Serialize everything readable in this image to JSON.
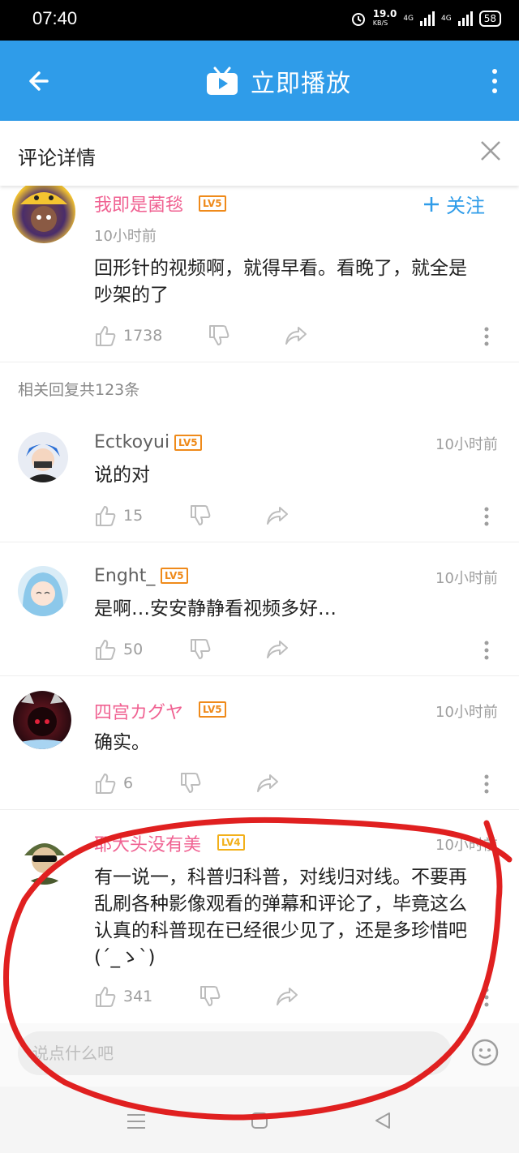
{
  "status": {
    "time": "07:40",
    "speed": "19.0",
    "speed_unit": "KB/S",
    "net1": "4G",
    "net2": "4G",
    "battery": "58"
  },
  "appbar": {
    "title": "立即播放",
    "icons": [
      "back-arrow-icon",
      "tv-play-icon",
      "more-vert-icon"
    ],
    "color": "#2f9ce9"
  },
  "detail": {
    "title": "评论详情"
  },
  "main_comment": {
    "user": "我即是菌毯",
    "level": "LV5",
    "follow": "关注",
    "time": "10小时前",
    "text_line1": "回形针的视频啊，就得早看。看晚了，就全是",
    "text_line2": "吵架的了",
    "likes": "1738"
  },
  "reply_count": "相关回复共123条",
  "replies": [
    {
      "user": "Ectkoyui",
      "level": "LV5",
      "time": "10小时前",
      "text": "说的对",
      "likes": "15"
    },
    {
      "user": "Enght_",
      "level": "LV5",
      "time": "10小时前",
      "text": "是啊…安安静静看视频多好…",
      "likes": "50"
    },
    {
      "user": "四宫カグヤ",
      "level": "LV5",
      "time": "10小时前",
      "text": "确实。",
      "likes": "6"
    },
    {
      "user": "耶大头没有美",
      "level": "LV4",
      "time": "10小时前",
      "line1": "有一说一，科普归科普，对线归对线。不要再",
      "line2": "乱刷各种影像观看的弹幕和评论了，毕竟这么",
      "line3": "认真的科普现在已经很少见了，还是多珍惜吧",
      "line4": "(´_ゝ`)",
      "likes": "341"
    }
  ],
  "input": {
    "placeholder": "说点什么吧"
  },
  "colors": {
    "accent": "#2f9ce9",
    "pink_name": "#f06292",
    "level_badge": "#ef8a1a",
    "annotation_red": "#e02020"
  }
}
